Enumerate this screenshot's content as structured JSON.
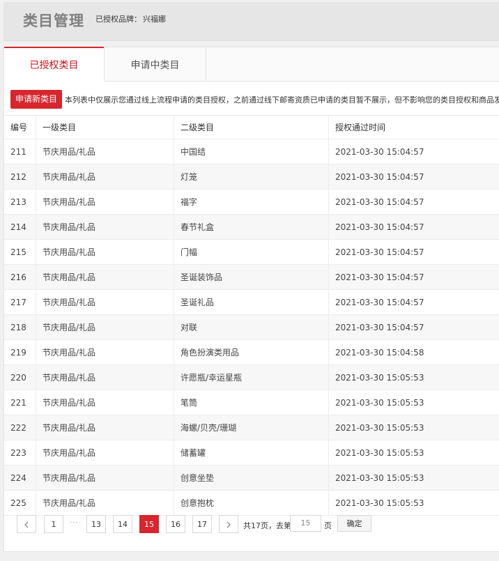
{
  "header": {
    "title": "类目管理",
    "brand_label": "已授权品牌：",
    "brand_value": "兴福娜"
  },
  "tabs": [
    {
      "label": "已授权类目",
      "active": true
    },
    {
      "label": "申请中类目",
      "active": false
    }
  ],
  "toolbar": {
    "apply_label": "申请新类目",
    "notice": "本列表中仅展示您通过线上流程申请的类目授权，之前通过线下邮寄资质已申请的类目暂不展示，但不影响您的类目授权和商品发布"
  },
  "table": {
    "headers": [
      "编号",
      "一级类目",
      "二级类目",
      "授权通过时间"
    ],
    "rows": [
      [
        "211",
        "节庆用品/礼品",
        "中国结",
        "2021-03-30 15:04:57"
      ],
      [
        "212",
        "节庆用品/礼品",
        "灯笼",
        "2021-03-30 15:04:57"
      ],
      [
        "213",
        "节庆用品/礼品",
        "福字",
        "2021-03-30 15:04:57"
      ],
      [
        "214",
        "节庆用品/礼品",
        "春节礼盒",
        "2021-03-30 15:04:57"
      ],
      [
        "215",
        "节庆用品/礼品",
        "门幅",
        "2021-03-30 15:04:57"
      ],
      [
        "216",
        "节庆用品/礼品",
        "圣诞装饰品",
        "2021-03-30 15:04:57"
      ],
      [
        "217",
        "节庆用品/礼品",
        "圣诞礼品",
        "2021-03-30 15:04:57"
      ],
      [
        "218",
        "节庆用品/礼品",
        "对联",
        "2021-03-30 15:04:57"
      ],
      [
        "219",
        "节庆用品/礼品",
        "角色扮演类用品",
        "2021-03-30 15:04:58"
      ],
      [
        "220",
        "节庆用品/礼品",
        "许愿瓶/幸运星瓶",
        "2021-03-30 15:05:53"
      ],
      [
        "221",
        "节庆用品/礼品",
        "笔筒",
        "2021-03-30 15:05:53"
      ],
      [
        "222",
        "节庆用品/礼品",
        "海螺/贝壳/珊瑚",
        "2021-03-30 15:05:53"
      ],
      [
        "223",
        "节庆用品/礼品",
        "储蓄罐",
        "2021-03-30 15:05:53"
      ],
      [
        "224",
        "节庆用品/礼品",
        "创意坐垫",
        "2021-03-30 15:05:53"
      ],
      [
        "225",
        "节庆用品/礼品",
        "创意抱枕",
        "2021-03-30 15:05:53"
      ]
    ]
  },
  "pager": {
    "prev_icon": "chevron-left-icon",
    "next_icon": "chevron-right-icon",
    "pages": [
      "1",
      "13",
      "14",
      "15",
      "16",
      "17"
    ],
    "ellipsis": "···",
    "current": "15",
    "total_text": "共17页，去第",
    "input_value": "15",
    "unit": "页",
    "go_label": "确定"
  },
  "colors": {
    "accent": "#d7262d",
    "header_bg": "#e6e6e6",
    "title_gray": "#7f7f7f"
  }
}
